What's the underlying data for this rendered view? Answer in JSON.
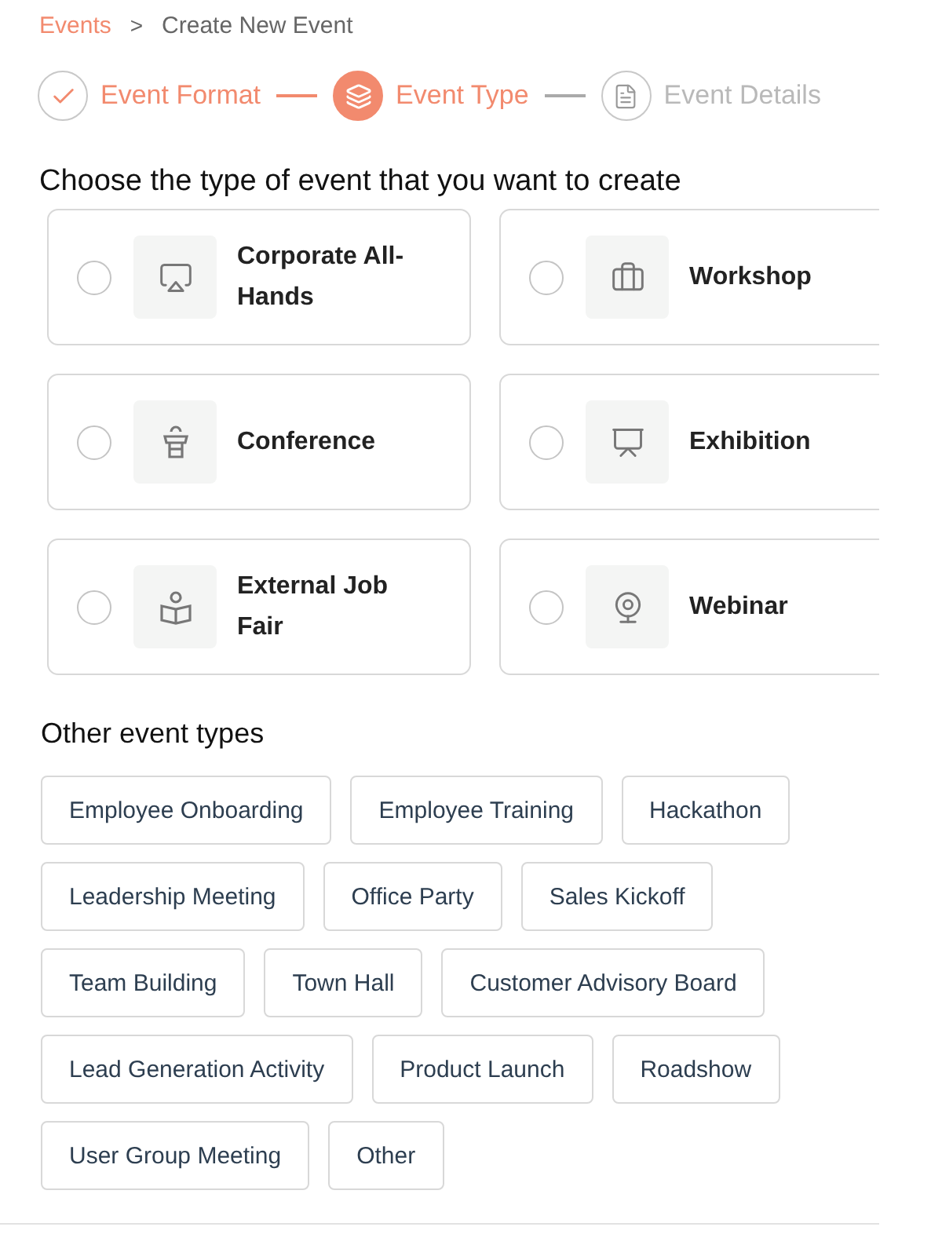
{
  "breadcrumb": {
    "link": "Events",
    "separator": ">",
    "current": "Create New Event"
  },
  "steps": [
    {
      "label": "Event Format",
      "completed": true,
      "selected": false
    },
    {
      "label": "Event Type",
      "completed": false,
      "selected": true
    },
    {
      "label": "Event Details",
      "completed": false,
      "selected": false
    }
  ],
  "heading": "Choose the type of event that you want to create",
  "event_types": [
    {
      "label": "Corporate All-Hands",
      "selected": false
    },
    {
      "label": "Workshop",
      "selected": false
    },
    {
      "label": "Conference",
      "selected": false
    },
    {
      "label": "Exhibition",
      "selected": false
    },
    {
      "label": "External Job Fair",
      "selected": false
    },
    {
      "label": "Webinar",
      "selected": false
    }
  ],
  "other_heading": "Other event types",
  "other_types": [
    "Employee Onboarding",
    "Employee Training",
    "Hackathon",
    "Leadership Meeting",
    "Office Party",
    "Sales Kickoff",
    "Team Building",
    "Town Hall",
    "Customer Advisory Board",
    "Lead Generation Activity",
    "Product Launch",
    "Roadshow",
    "User Group Meeting",
    "Other"
  ]
}
